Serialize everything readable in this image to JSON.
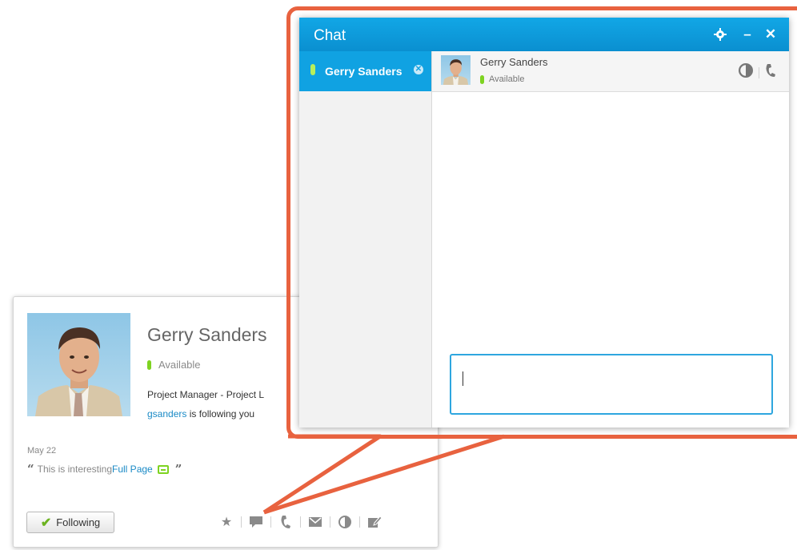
{
  "profile_card": {
    "name": "Gerry Sanders",
    "status": "Available",
    "job_title": "Project Manager - Project L",
    "follower_user": "gsanders",
    "follower_text": " is following you",
    "date": "May 22",
    "quote_text": "This is interesting ",
    "quote_link": "Full Page",
    "follow_button": "Following",
    "actions": [
      "star-icon",
      "chat-icon",
      "phone-icon",
      "mail-icon",
      "contrast-icon",
      "edit-icon"
    ]
  },
  "chat_window": {
    "title": "Chat",
    "controls": [
      "gear-icon",
      "minimize-icon",
      "close-icon"
    ],
    "tab": {
      "name": "Gerry Sanders"
    },
    "contact": {
      "name": "Gerry Sanders",
      "status": "Available"
    },
    "message_input_value": ""
  },
  "colors": {
    "accent": "#10a2e2",
    "callout": "#e8623f",
    "available": "#7ed321",
    "link": "#1a8ac6"
  }
}
